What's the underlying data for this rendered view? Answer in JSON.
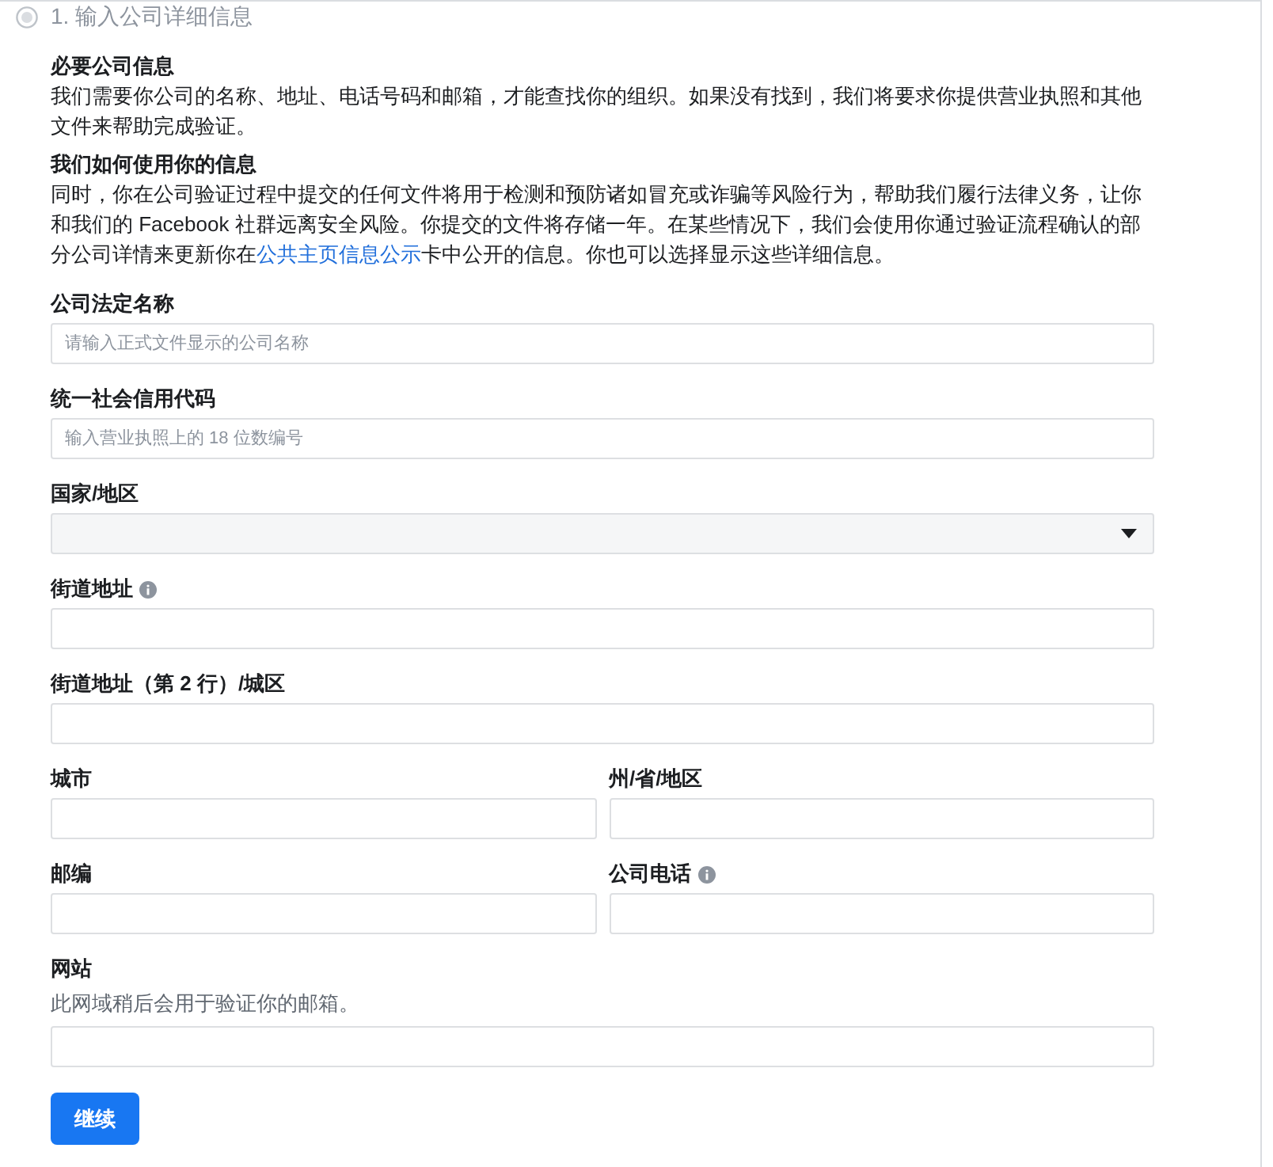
{
  "step": {
    "title": "1. 输入公司详细信息",
    "selected": false
  },
  "sections": [
    {
      "heading": "必要公司信息",
      "body": "我们需要你公司的名称、地址、电话号码和邮箱，才能查找你的组织。如果没有找到，我们将要求你提供营业执照和其他文件来帮助完成验证。"
    },
    {
      "heading": "我们如何使用你的信息",
      "body": "同时，你在公司验证过程中提交的任何文件将用于检测和预防诸如冒充或诈骗等风险行为，帮助我们履行法律义务，让你和我们的 Facebook 社群远离安全风险。你提交的文件将存储一年。在某些情况下，我们会使用你通过验证流程确认的部分公司详情来更新你在",
      "link": "公共主页信息公示",
      "body_after": "卡中公开的信息。你也可以选择显示这些详细信息。"
    }
  ],
  "form_rows": [
    {
      "fields": [
        {
          "kind": "text",
          "label": "公司法定名称",
          "info": false,
          "placeholder": "请输入正式文件显示的公司名称"
        }
      ]
    },
    {
      "fields": [
        {
          "kind": "text",
          "label": "统一社会信用代码",
          "info": false,
          "placeholder": "输入营业执照上的 18 位数编号"
        }
      ]
    },
    {
      "fields": [
        {
          "kind": "select",
          "label": "国家/地区",
          "info": false
        }
      ]
    },
    {
      "fields": [
        {
          "kind": "text",
          "label": "街道地址",
          "info": true
        }
      ]
    },
    {
      "fields": [
        {
          "kind": "text",
          "label": "街道地址（第 2 行）/城区",
          "info": false
        }
      ]
    },
    {
      "fields": [
        {
          "kind": "text",
          "label": "城市",
          "info": false
        },
        {
          "kind": "text",
          "label": "州/省/地区",
          "info": false
        }
      ]
    },
    {
      "fields": [
        {
          "kind": "text",
          "label": "邮编",
          "info": false
        },
        {
          "kind": "text",
          "label": "公司电话",
          "info": true
        }
      ]
    },
    {
      "fields": [
        {
          "kind": "text",
          "label": "网站",
          "info": false,
          "hint": "此网域稍后会用于验证你的邮箱。"
        }
      ]
    }
  ],
  "continue_button": "继续"
}
